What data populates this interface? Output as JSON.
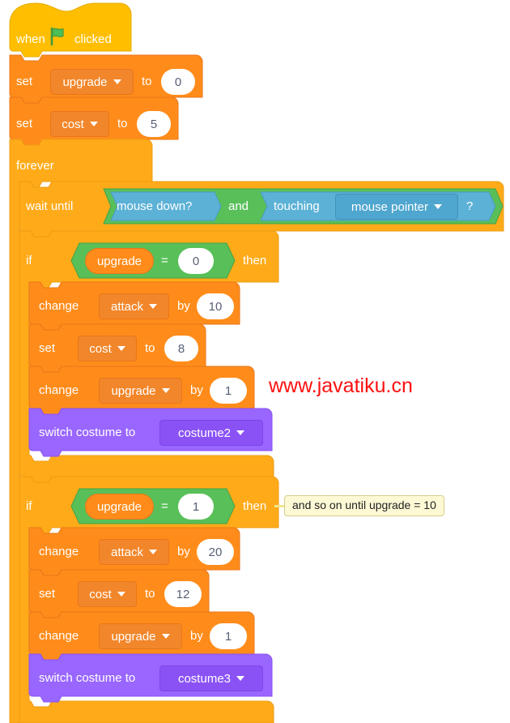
{
  "program": {
    "title": "Scratch script - upgrade shop",
    "colors": {
      "events": "#ffbf00",
      "control": "#ffab19",
      "variables": "#ff8c1a",
      "looks": "#9966ff",
      "operators": "#59c059",
      "sensing": "#5cb1d6",
      "input_white": "#ffffff",
      "text_light": "#ffffff",
      "text_dark": "#575e75",
      "comment_bg": "#fef9d5",
      "watermark": "#fc1010"
    },
    "blocks": {
      "hat": {
        "when": "when",
        "clicked": "clicked",
        "flag_icon": "green-flag-icon"
      },
      "set_upgrade": {
        "set": "set",
        "variable": "upgrade",
        "to": "to",
        "value": "0"
      },
      "set_cost": {
        "set": "set",
        "variable": "cost",
        "to": "to",
        "value": "5"
      },
      "forever": {
        "label": "forever"
      },
      "wait_until": {
        "label": "wait until",
        "operand_a": "mouse down?",
        "operator": "and",
        "touching": "touching",
        "target": "mouse pointer",
        "question": "?"
      },
      "if_1": {
        "if": "if",
        "variable": "upgrade",
        "equals": "=",
        "value": "0",
        "then": "then",
        "body": [
          {
            "type": "change",
            "label": "change",
            "variable": "attack",
            "by": "by",
            "value": "10"
          },
          {
            "type": "set",
            "label": "set",
            "variable": "cost",
            "to": "to",
            "value": "8"
          },
          {
            "type": "change",
            "label": "change",
            "variable": "upgrade",
            "by": "by",
            "value": "1"
          },
          {
            "type": "looks",
            "label": "switch costume to",
            "costume": "costume2"
          }
        ]
      },
      "if_2": {
        "if": "if",
        "variable": "upgrade",
        "equals": "=",
        "value": "1",
        "then": "then",
        "comment": "and so on until upgrade = 10",
        "body": [
          {
            "type": "change",
            "label": "change",
            "variable": "attack",
            "by": "by",
            "value": "20"
          },
          {
            "type": "set",
            "label": "set",
            "variable": "cost",
            "to": "to",
            "value": "12"
          },
          {
            "type": "change",
            "label": "change",
            "variable": "upgrade",
            "by": "by",
            "value": "1"
          },
          {
            "type": "looks",
            "label": "switch costume to",
            "costume": "costume3"
          }
        ]
      }
    },
    "watermark": {
      "text": "www.javatiku.cn"
    }
  }
}
